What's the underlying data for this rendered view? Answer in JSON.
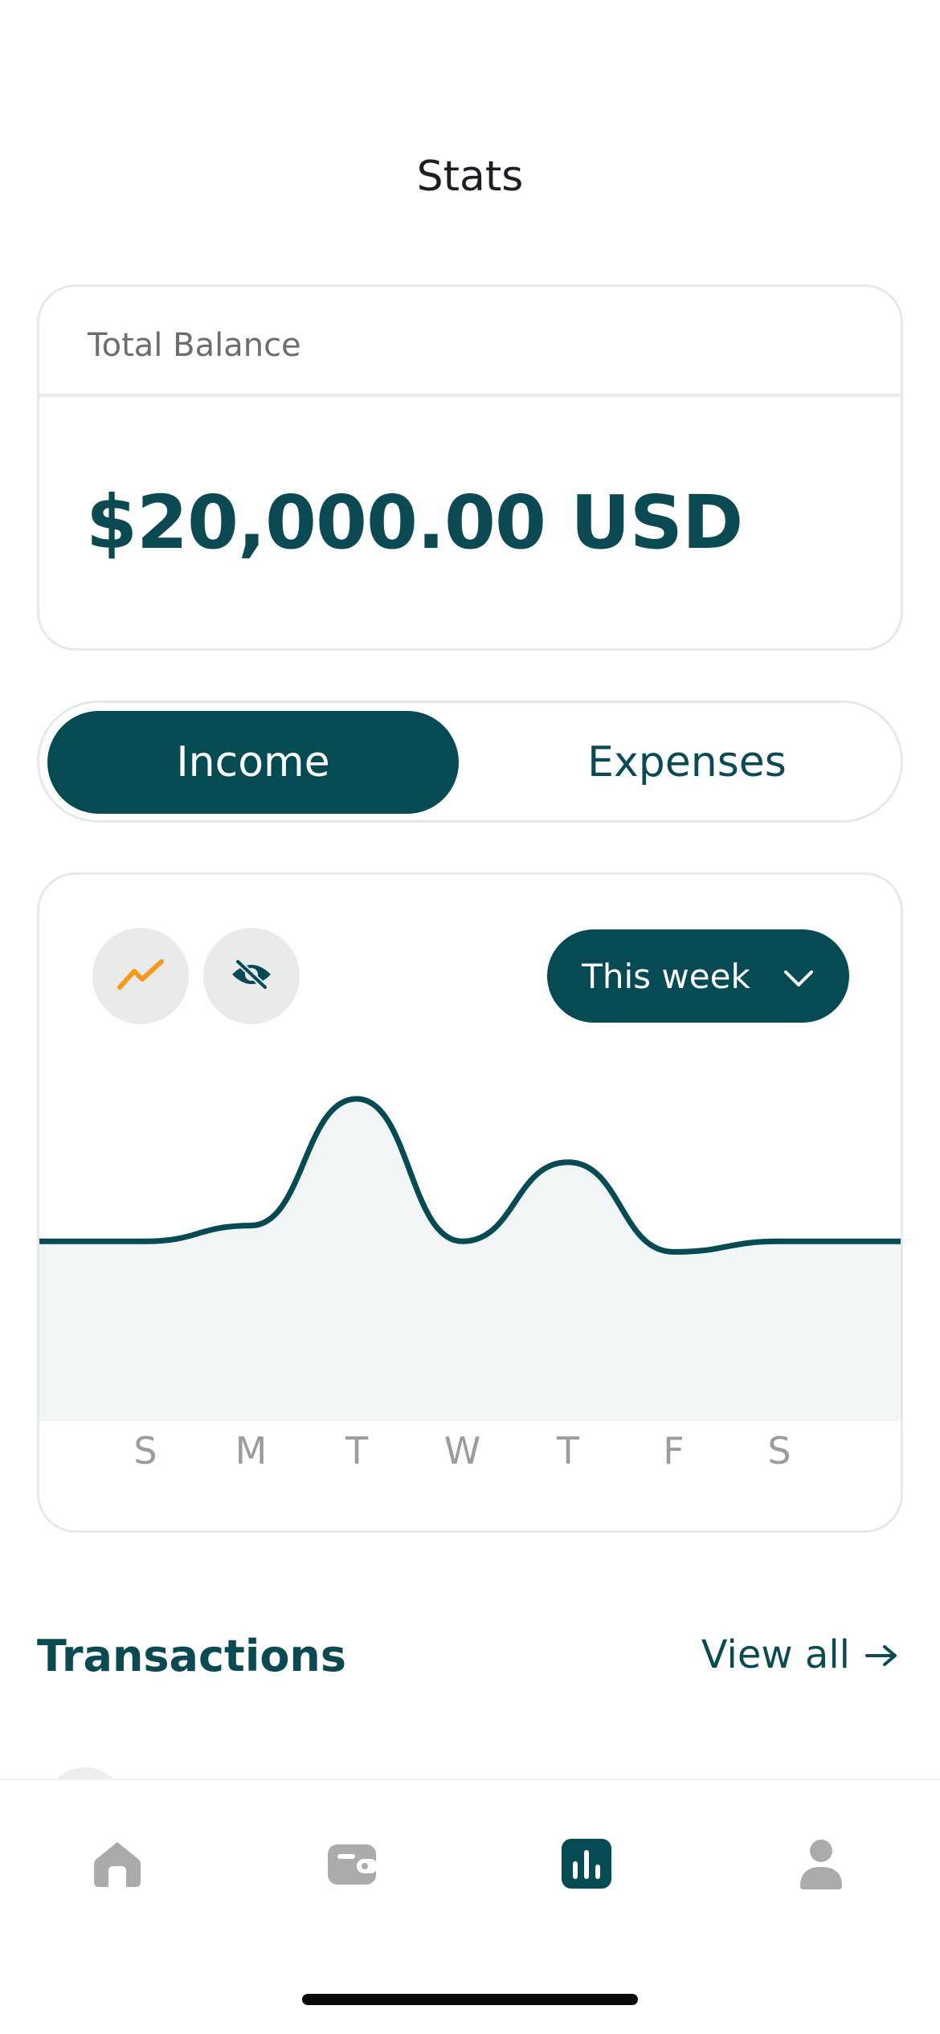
{
  "header": {
    "title": "Stats"
  },
  "balance": {
    "label": "Total Balance",
    "amount": "$20,000.00 USD"
  },
  "segment": {
    "income_label": "Income",
    "expenses_label": "Expenses",
    "selected": "Income"
  },
  "chart_controls": {
    "trend_icon": "trend-line-icon",
    "visibility_icon": "eye-slash-icon",
    "range_label": "This week"
  },
  "chart_data": {
    "type": "area",
    "categories": [
      "S",
      "M",
      "T",
      "W",
      "T",
      "F",
      "S"
    ],
    "values": [
      3.1,
      3.4,
      5.8,
      3.1,
      4.6,
      2.9,
      3.1
    ],
    "title": "",
    "xlabel": "",
    "ylabel": "",
    "grid": false,
    "colors": {
      "line": "#064a54",
      "fill": "#f1f5f5"
    }
  },
  "transactions": {
    "title": "Transactions",
    "view_all_label": "View all",
    "view_all_icon": "arrow-right-icon"
  },
  "tabbar": {
    "items": [
      {
        "name": "home",
        "icon": "home-icon",
        "active": false
      },
      {
        "name": "wallet",
        "icon": "wallet-icon",
        "active": false
      },
      {
        "name": "stats",
        "icon": "bar-chart-icon",
        "active": true
      },
      {
        "name": "profile",
        "icon": "user-icon",
        "active": false
      }
    ]
  },
  "colors": {
    "accent": "#064a54",
    "trend_icon": "#f39a1e",
    "inactive_icon": "#a9abad"
  }
}
